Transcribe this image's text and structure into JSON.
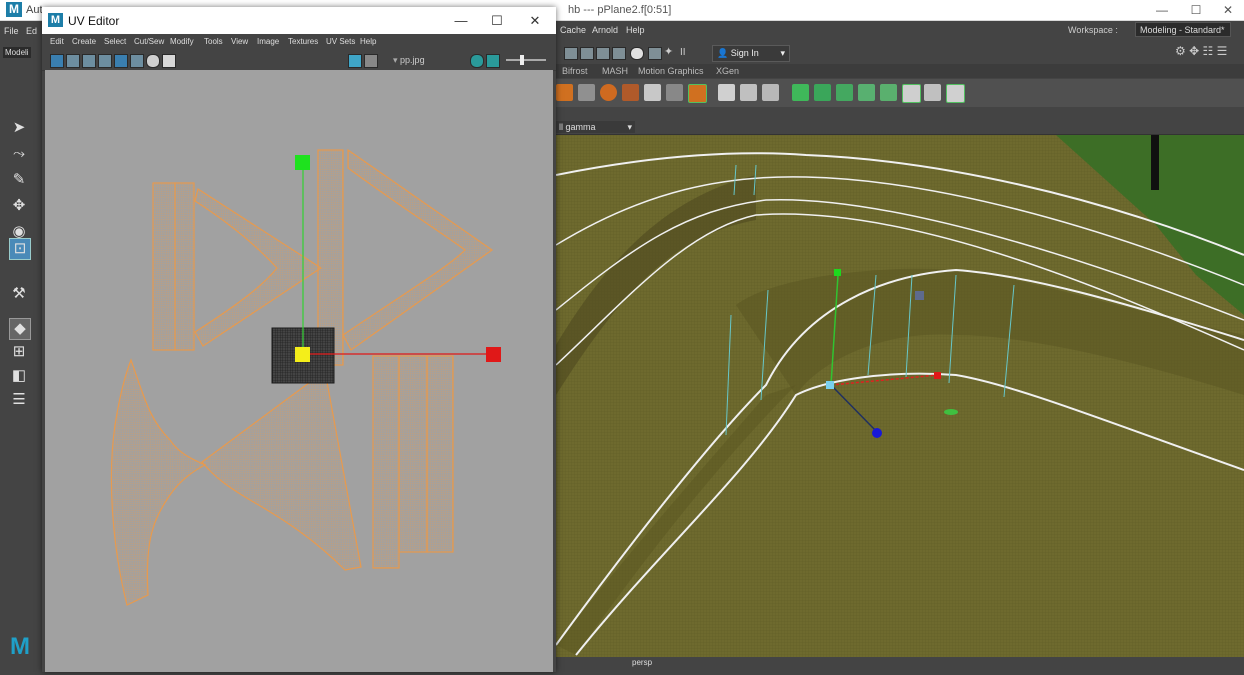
{
  "maya": {
    "title_left": "Auto",
    "title_right": "hb --- pPlane2.f[0:51]",
    "menus_left": [
      "File",
      "Ed"
    ],
    "menus_right": [
      "Cache",
      "Arnold",
      "Help"
    ],
    "workspace_label": "Workspace :",
    "workspace_value": "Modeling - Standard*",
    "sign_in": "Sign In",
    "shelf_tabs": [
      "Bifrost",
      "MASH",
      "Motion Graphics",
      "XGen"
    ],
    "left_menu_fragment": "Modeli",
    "viewport_field": "ll gamma",
    "viewport_label": "persp",
    "colors": {
      "uv_outline": "#e79a4e",
      "uv_background": "#a1a1a1",
      "ground": "#6e6a2e"
    }
  },
  "uv_editor": {
    "title": "UV Editor",
    "menus": [
      "Edit",
      "Create",
      "Select",
      "Cut/Sew",
      "Modify",
      "Tools",
      "View",
      "Image",
      "Textures",
      "UV Sets",
      "Help"
    ],
    "image_name": "pp.jpg"
  },
  "window_controls": {
    "minimize": "—",
    "maximize": "☐",
    "close": "✕"
  }
}
